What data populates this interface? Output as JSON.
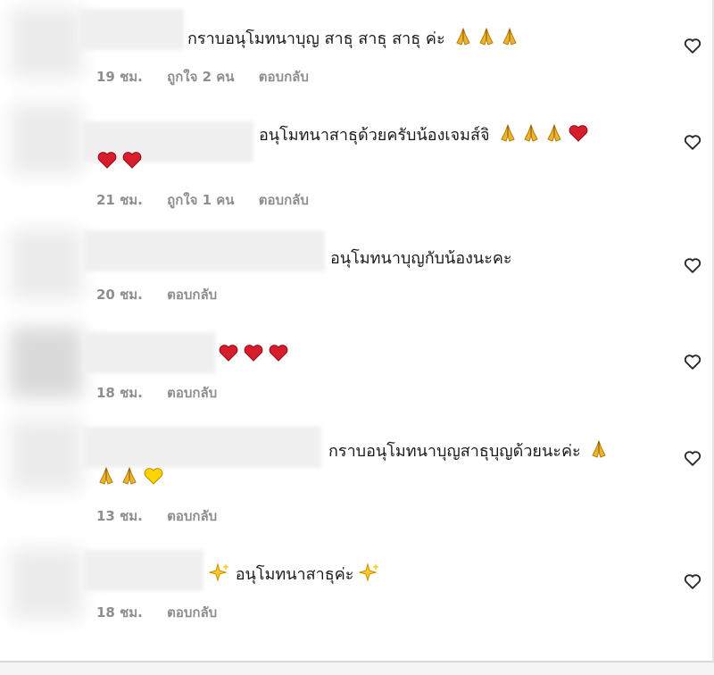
{
  "comments": [
    {
      "text": "กราบอนุโมทนาบุญ สาธุ สาธุ สาธุ ค่ะ",
      "emojis": [
        "pray-icon",
        "pray-icon",
        "pray-icon"
      ],
      "line2": [],
      "time": "19 ชม.",
      "likes": "ถูกใจ 2 คน",
      "reply": "ตอบกลับ"
    },
    {
      "text": "อนุโมทนาสาธุด้วยครับน้องเจมส์จิ",
      "emojis": [
        "pray-icon",
        "pray-icon",
        "pray-icon",
        "red-heart-icon"
      ],
      "line2": [
        "red-heart-icon",
        "red-heart-icon"
      ],
      "time": "21 ชม.",
      "likes": "ถูกใจ 1 คน",
      "reply": "ตอบกลับ"
    },
    {
      "text": "อนุโมทนาบุญกับน้องนะคะ",
      "emojis": [],
      "line2": [],
      "time": "20 ชม.",
      "likes": "",
      "reply": "ตอบกลับ"
    },
    {
      "text": "",
      "emojis": [
        "red-heart-icon",
        "red-heart-icon",
        "red-heart-icon"
      ],
      "line2": [],
      "time": "18 ชม.",
      "likes": "",
      "reply": "ตอบกลับ"
    },
    {
      "text": "กราบอนุโมทนาบุญสาธุบุญด้วยนะค่ะ",
      "emojis": [
        "pray-icon"
      ],
      "line2": [
        "pray-icon",
        "pray-icon",
        "yellow-heart-icon"
      ],
      "time": "13 ชม.",
      "likes": "",
      "reply": "ตอบกลับ"
    },
    {
      "text": "อนุโมทนาสาธุค่ะ",
      "emojis": [],
      "line2": [],
      "prefix": "sparkles-icon",
      "suffix": "sparkles-icon",
      "time": "18 ชม.",
      "likes": "",
      "reply": "ตอบกลับ"
    }
  ]
}
